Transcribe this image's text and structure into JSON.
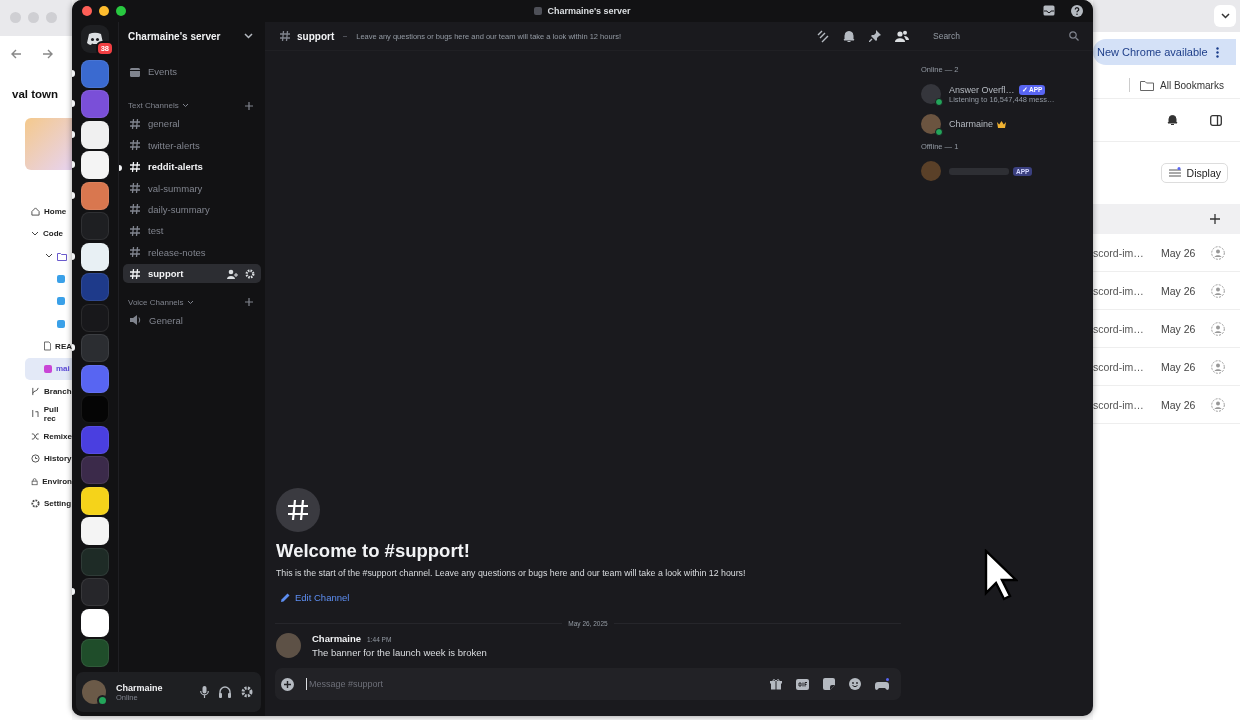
{
  "browser": {
    "sidebar": {
      "title": "val town",
      "items": [
        {
          "label": "Home",
          "kind": "home",
          "selected": false
        },
        {
          "label": "Code",
          "kind": "group",
          "selected": false
        },
        {
          "kind": "folder",
          "selected": false
        },
        {
          "kind": "file",
          "selected": false
        },
        {
          "kind": "file",
          "selected": false
        },
        {
          "kind": "file",
          "selected": false
        },
        {
          "label": "REA",
          "kind": "doc",
          "selected": false
        },
        {
          "label": "mai",
          "kind": "file",
          "selected": true
        },
        {
          "label": "Branch",
          "kind": "branch",
          "selected": false
        },
        {
          "label": "Pull rec",
          "kind": "pull",
          "selected": false
        },
        {
          "label": "Remixe",
          "kind": "remix",
          "selected": false
        },
        {
          "label": "History",
          "kind": "history",
          "selected": false
        },
        {
          "label": "Environ",
          "kind": "lock",
          "selected": false
        },
        {
          "label": "Setting",
          "kind": "gear",
          "selected": false
        }
      ]
    },
    "update_button": "New Chrome available",
    "bookmarks": "All Bookmarks",
    "display_button": "Display",
    "rows": [
      {
        "name": "scord-im…",
        "date": "May 26"
      },
      {
        "name": "scord-im…",
        "date": "May 26"
      },
      {
        "name": "scord-im…",
        "date": "May 26"
      },
      {
        "name": "scord-im…",
        "date": "May 26"
      },
      {
        "name": "scord-im…",
        "date": "May 26"
      }
    ]
  },
  "discord": {
    "window": {
      "title": "Charmaine's server"
    },
    "home_badge": "38",
    "servers": [
      {
        "color": "#3a6ad0",
        "unread": true
      },
      {
        "color": "#7a4fd8",
        "unread": true
      },
      {
        "color": "#f0f0f0",
        "unread": true
      },
      {
        "color": "#f4f4f4",
        "unread": true
      },
      {
        "color": "#d9774f",
        "unread": true
      },
      {
        "color": "#1e1f22",
        "unread": false
      },
      {
        "color": "#e8f0f4",
        "unread": true
      },
      {
        "color": "#1e3a8a",
        "unread": false
      },
      {
        "color": "#18181b",
        "unread": false
      },
      {
        "color": "#2b2d31",
        "unread": true
      },
      {
        "color": "#5865f2",
        "unread": false
      },
      {
        "color": "#050505",
        "unread": false
      },
      {
        "color": "#4a3fe0",
        "unread": false
      },
      {
        "color": "#3b2a4a",
        "unread": false
      },
      {
        "color": "#f5d31a",
        "unread": false
      },
      {
        "color": "#f4f4f4",
        "unread": false
      },
      {
        "color": "#1e2b26",
        "unread": false
      },
      {
        "color": "#26262a",
        "unread": true
      },
      {
        "color": "#ffffff",
        "unread": false
      },
      {
        "color": "#1f4d2a",
        "unread": false
      }
    ],
    "server_name": "Charmaine's server",
    "events": "Events",
    "categories": [
      {
        "name": "Text Channels",
        "expanded": true,
        "channels": [
          {
            "name": "general",
            "kind": "text",
            "selected": false,
            "unread": false
          },
          {
            "name": "twitter-alerts",
            "kind": "text",
            "selected": false,
            "unread": false
          },
          {
            "name": "reddit-alerts",
            "kind": "text",
            "selected": false,
            "unread": true
          },
          {
            "name": "val-summary",
            "kind": "text",
            "selected": false,
            "unread": false
          },
          {
            "name": "daily-summary",
            "kind": "text",
            "selected": false,
            "unread": false
          },
          {
            "name": "test",
            "kind": "text",
            "selected": false,
            "unread": false
          },
          {
            "name": "release-notes",
            "kind": "text",
            "selected": false,
            "unread": false
          },
          {
            "name": "support",
            "kind": "text",
            "selected": true,
            "unread": false
          }
        ]
      },
      {
        "name": "Voice Channels",
        "expanded": true,
        "channels": [
          {
            "name": "General",
            "kind": "voice",
            "selected": false,
            "unread": false
          }
        ]
      }
    ],
    "user": {
      "name": "Charmaine",
      "status": "Online"
    },
    "header": {
      "channel": "support",
      "topic": "Leave any questions or bugs here and our team will take a look within 12 hours!",
      "search": {
        "placeholder": "Search"
      }
    },
    "welcome": {
      "title": "Welcome to #support!",
      "text": "This is the start of the #support channel. Leave any questions or bugs here and our team will take a look within 12 hours!",
      "edit_link": "Edit Channel"
    },
    "date_divider": "May 26, 2025",
    "messages": [
      {
        "author": "Charmaine",
        "time": "1:44 PM",
        "text": "The banner for the launch week is broken"
      }
    ],
    "composer": {
      "placeholder": "Message #support"
    },
    "members": {
      "groups": [
        {
          "title": "Online — 2",
          "members": [
            {
              "name": "Answer Overfl…",
              "badge": "✓ APP",
              "activity": "Listening to 16,547,448 mess…",
              "owner": false,
              "online": true
            },
            {
              "name": "Charmaine",
              "owner": true,
              "online": true
            }
          ]
        },
        {
          "title": "Offline — 1",
          "members": [
            {
              "badge": "APP",
              "owner": false,
              "online": false
            }
          ]
        }
      ]
    }
  }
}
